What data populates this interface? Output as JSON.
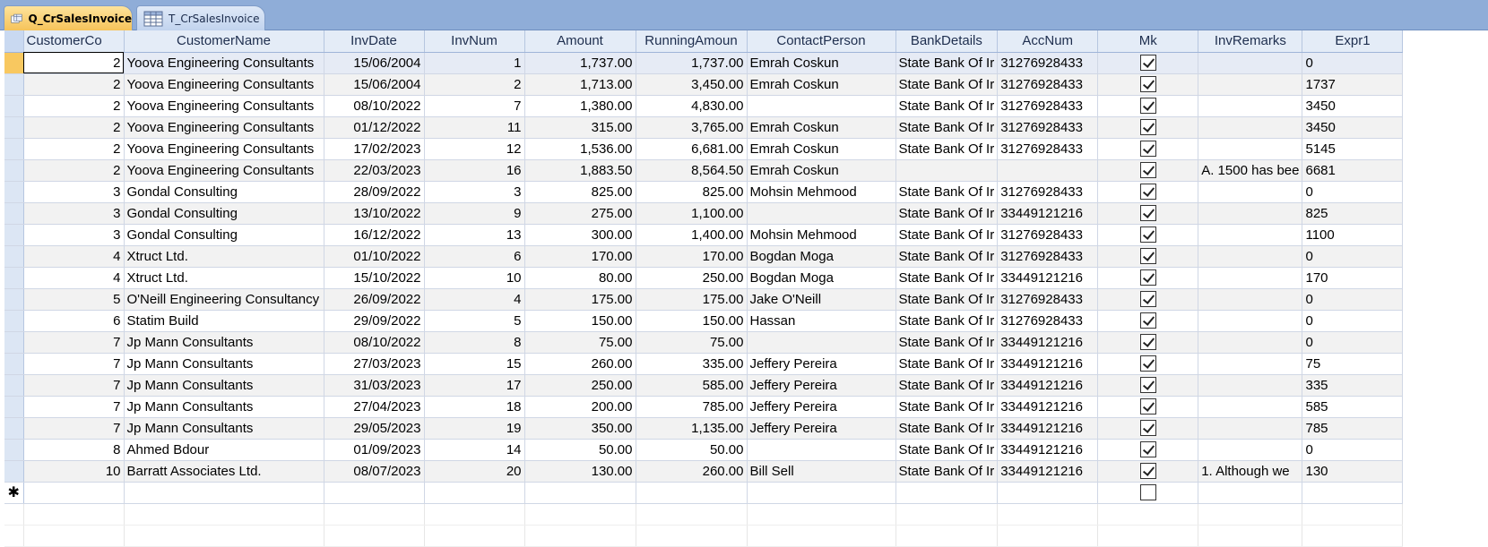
{
  "tabs": [
    {
      "label": "Q_CrSalesInvoice",
      "icon": "query-icon"
    },
    {
      "label": "T_CrSalesInvoice",
      "icon": "table-icon"
    }
  ],
  "columns": [
    "CustomerCo",
    "CustomerName",
    "InvDate",
    "InvNum",
    "Amount",
    "RunningAmoun",
    "ContactPerson",
    "BankDetails",
    "AccNum",
    "Mk",
    "InvRemarks",
    "Expr1"
  ],
  "rows": [
    {
      "cust": "2",
      "name": "Yoova Engineering Consultants",
      "date": "15/06/2004",
      "num": "1",
      "amount": "1,737.00",
      "running": "1,737.00",
      "contact": "Emrah Coskun",
      "bank": "State Bank Of Ir",
      "acc": "31276928433",
      "mk": true,
      "remarks": "",
      "expr": "0"
    },
    {
      "cust": "2",
      "name": "Yoova Engineering Consultants",
      "date": "15/06/2004",
      "num": "2",
      "amount": "1,713.00",
      "running": "3,450.00",
      "contact": "Emrah Coskun",
      "bank": "State Bank Of Ir",
      "acc": "31276928433",
      "mk": true,
      "remarks": "",
      "expr": "1737"
    },
    {
      "cust": "2",
      "name": "Yoova Engineering Consultants",
      "date": "08/10/2022",
      "num": "7",
      "amount": "1,380.00",
      "running": "4,830.00",
      "contact": "",
      "bank": "State Bank Of Ir",
      "acc": "31276928433",
      "mk": true,
      "remarks": "",
      "expr": "3450"
    },
    {
      "cust": "2",
      "name": "Yoova Engineering Consultants",
      "date": "01/12/2022",
      "num": "11",
      "amount": "315.00",
      "running": "3,765.00",
      "contact": "Emrah Coskun",
      "bank": "State Bank Of Ir",
      "acc": "31276928433",
      "mk": true,
      "remarks": "",
      "expr": "3450"
    },
    {
      "cust": "2",
      "name": "Yoova Engineering Consultants",
      "date": "17/02/2023",
      "num": "12",
      "amount": "1,536.00",
      "running": "6,681.00",
      "contact": "Emrah Coskun",
      "bank": "State Bank Of Ir",
      "acc": "31276928433",
      "mk": true,
      "remarks": "",
      "expr": "5145"
    },
    {
      "cust": "2",
      "name": "Yoova Engineering Consultants",
      "date": "22/03/2023",
      "num": "16",
      "amount": "1,883.50",
      "running": "8,564.50",
      "contact": "Emrah Coskun",
      "bank": "",
      "acc": "",
      "mk": true,
      "remarks": "A. 1500 has bee",
      "expr": "6681"
    },
    {
      "cust": "3",
      "name": "Gondal Consulting",
      "date": "28/09/2022",
      "num": "3",
      "amount": "825.00",
      "running": "825.00",
      "contact": "Mohsin Mehmood",
      "bank": "State Bank Of Ir",
      "acc": "31276928433",
      "mk": true,
      "remarks": "",
      "expr": "0"
    },
    {
      "cust": "3",
      "name": "Gondal Consulting",
      "date": "13/10/2022",
      "num": "9",
      "amount": "275.00",
      "running": "1,100.00",
      "contact": "",
      "bank": "State Bank Of Ir",
      "acc": "33449121216",
      "mk": true,
      "remarks": "",
      "expr": "825"
    },
    {
      "cust": "3",
      "name": "Gondal Consulting",
      "date": "16/12/2022",
      "num": "13",
      "amount": "300.00",
      "running": "1,400.00",
      "contact": "Mohsin Mehmood",
      "bank": "State Bank Of Ir",
      "acc": "31276928433",
      "mk": true,
      "remarks": "",
      "expr": "1100"
    },
    {
      "cust": "4",
      "name": "Xtruct Ltd.",
      "date": "01/10/2022",
      "num": "6",
      "amount": "170.00",
      "running": "170.00",
      "contact": "Bogdan Moga",
      "bank": "State Bank Of Ir",
      "acc": "31276928433",
      "mk": true,
      "remarks": "",
      "expr": "0"
    },
    {
      "cust": "4",
      "name": "Xtruct Ltd.",
      "date": "15/10/2022",
      "num": "10",
      "amount": "80.00",
      "running": "250.00",
      "contact": "Bogdan Moga",
      "bank": "State Bank Of Ir",
      "acc": "33449121216",
      "mk": true,
      "remarks": "",
      "expr": "170"
    },
    {
      "cust": "5",
      "name": "O'Neill Engineering Consultancy",
      "date": "26/09/2022",
      "num": "4",
      "amount": "175.00",
      "running": "175.00",
      "contact": "Jake O'Neill",
      "bank": "State Bank Of Ir",
      "acc": "31276928433",
      "mk": true,
      "remarks": "",
      "expr": "0"
    },
    {
      "cust": "6",
      "name": "Statim Build",
      "date": "29/09/2022",
      "num": "5",
      "amount": "150.00",
      "running": "150.00",
      "contact": "Hassan",
      "bank": "State Bank Of Ir",
      "acc": "31276928433",
      "mk": true,
      "remarks": "",
      "expr": "0"
    },
    {
      "cust": "7",
      "name": "Jp Mann Consultants",
      "date": "08/10/2022",
      "num": "8",
      "amount": "75.00",
      "running": "75.00",
      "contact": "",
      "bank": "State Bank Of Ir",
      "acc": "33449121216",
      "mk": true,
      "remarks": "",
      "expr": "0"
    },
    {
      "cust": "7",
      "name": "Jp Mann Consultants",
      "date": "27/03/2023",
      "num": "15",
      "amount": "260.00",
      "running": "335.00",
      "contact": "Jeffery Pereira",
      "bank": "State Bank Of Ir",
      "acc": "33449121216",
      "mk": true,
      "remarks": "",
      "expr": "75"
    },
    {
      "cust": "7",
      "name": "Jp Mann Consultants",
      "date": "31/03/2023",
      "num": "17",
      "amount": "250.00",
      "running": "585.00",
      "contact": "Jeffery Pereira",
      "bank": "State Bank Of Ir",
      "acc": "33449121216",
      "mk": true,
      "remarks": "",
      "expr": "335"
    },
    {
      "cust": "7",
      "name": "Jp Mann Consultants",
      "date": "27/04/2023",
      "num": "18",
      "amount": "200.00",
      "running": "785.00",
      "contact": "Jeffery Pereira",
      "bank": "State Bank Of Ir",
      "acc": "33449121216",
      "mk": true,
      "remarks": "",
      "expr": "585"
    },
    {
      "cust": "7",
      "name": "Jp Mann Consultants",
      "date": "29/05/2023",
      "num": "19",
      "amount": "350.00",
      "running": "1,135.00",
      "contact": "Jeffery Pereira",
      "bank": "State Bank Of Ir",
      "acc": "33449121216",
      "mk": true,
      "remarks": "",
      "expr": "785"
    },
    {
      "cust": "8",
      "name": "Ahmed Bdour",
      "date": "01/09/2023",
      "num": "14",
      "amount": "50.00",
      "running": "50.00",
      "contact": "",
      "bank": "State Bank Of Ir",
      "acc": "33449121216",
      "mk": true,
      "remarks": "",
      "expr": "0"
    },
    {
      "cust": "10",
      "name": "Barratt Associates Ltd.",
      "date": "08/07/2023",
      "num": "20",
      "amount": "130.00",
      "running": "260.00",
      "contact": "Bill Sell",
      "bank": "State Bank Of Ir",
      "acc": "33449121216",
      "mk": true,
      "remarks": "1. Although we",
      "expr": "130"
    }
  ],
  "new_record_marker": "✱",
  "colors": {
    "tab_active": "#f6c35a",
    "tabbar": "#8fadd8",
    "header": "#e4ecf7"
  }
}
